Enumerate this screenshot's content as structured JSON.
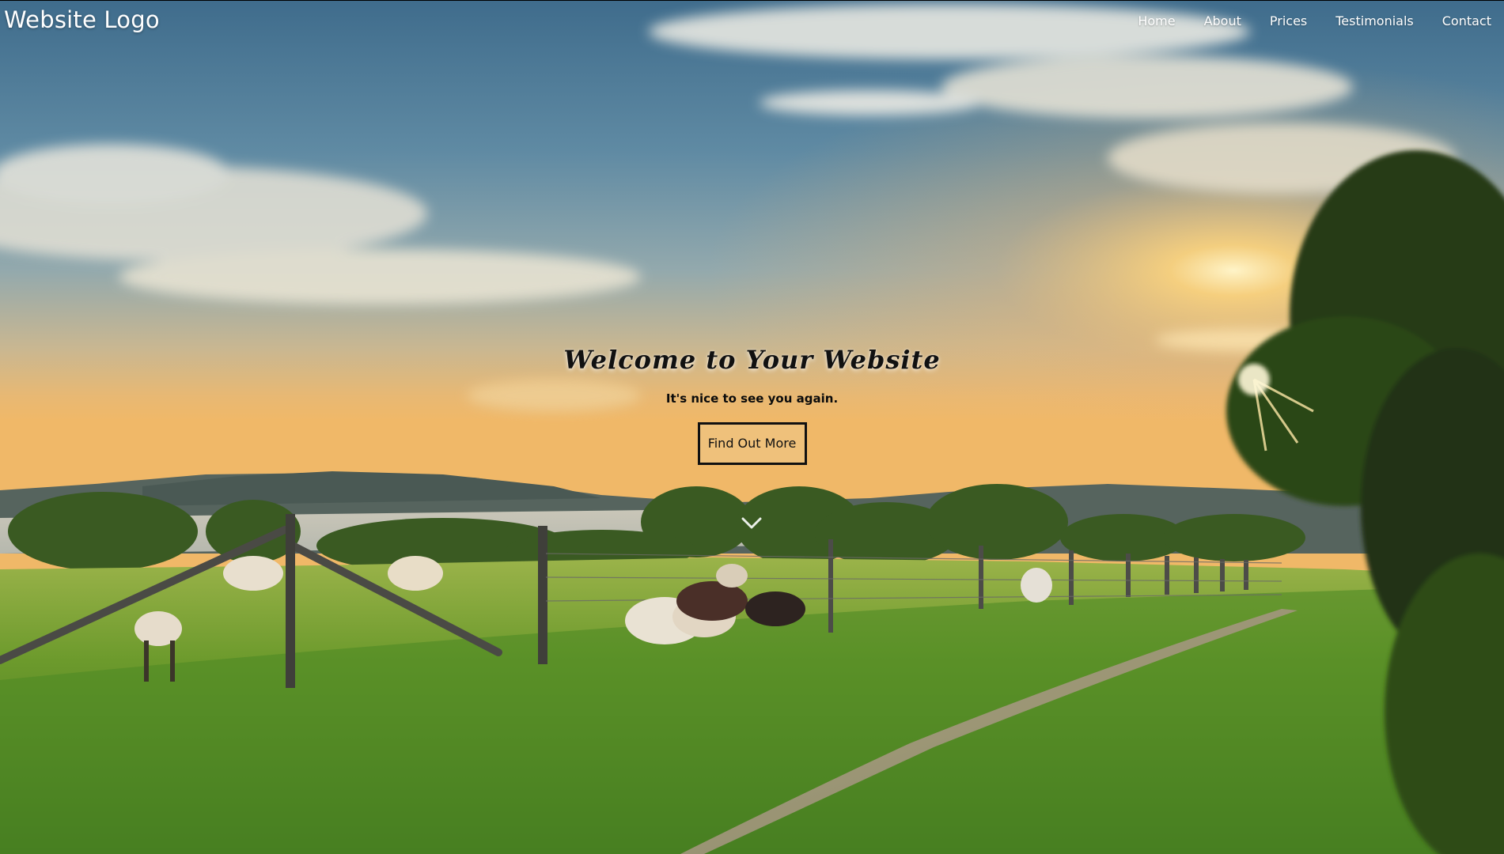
{
  "header": {
    "logo": "Website Logo",
    "nav": [
      {
        "label": "Home"
      },
      {
        "label": "About"
      },
      {
        "label": "Prices"
      },
      {
        "label": "Testimonials"
      },
      {
        "label": "Contact"
      }
    ]
  },
  "hero": {
    "title": "Welcome to Your Website",
    "subtitle": "It's nice to see you again.",
    "cta_label": "Find Out More",
    "background": "sunset-landscape-with-grazing-sheep",
    "scroll_icon": "chevron-down-icon"
  },
  "colors": {
    "nav_text": "#ffffff",
    "title_text": "#111111",
    "button_border": "#111111"
  }
}
